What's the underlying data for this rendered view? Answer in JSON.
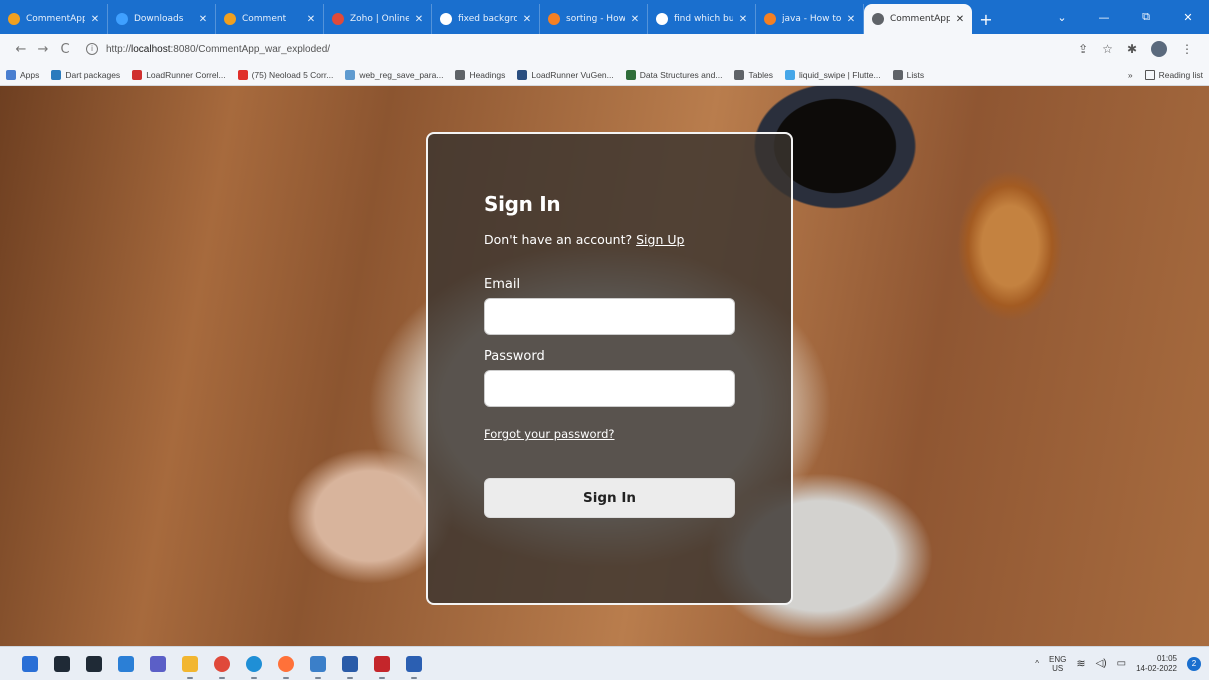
{
  "browser": {
    "tabs": [
      {
        "title": "CommentApp",
        "color": "#f0a020",
        "active": false
      },
      {
        "title": "Downloads",
        "color": "#3fa0ff",
        "active": false
      },
      {
        "title": "Comment",
        "color": "#f0a020",
        "active": false
      },
      {
        "title": "Zoho | Online",
        "color": "#e04a3a",
        "active": false
      },
      {
        "title": "fixed backgro",
        "color": "#ffffff",
        "active": false
      },
      {
        "title": "sorting - How",
        "color": "#f48024",
        "active": false
      },
      {
        "title": "find which but",
        "color": "#ffffff",
        "active": false
      },
      {
        "title": "java - How to",
        "color": "#f48024",
        "active": false
      },
      {
        "title": "CommentApp",
        "color": "#5f6368",
        "active": true
      }
    ],
    "new_tab": "+",
    "window_controls": {
      "chevron": "⌄",
      "minimize": "—",
      "restore": "⧉",
      "close": "✕"
    },
    "url": {
      "scheme": "http://",
      "host": "localhost",
      "rest": ":8080/CommentApp_war_exploded/"
    },
    "bookmarks": [
      {
        "label": "Apps",
        "color": "#4a7fd0"
      },
      {
        "label": "Dart packages",
        "color": "#2b7bbd"
      },
      {
        "label": "LoadRunner Correl...",
        "color": "#d0302f"
      },
      {
        "label": "(75) Neoload 5 Corr...",
        "color": "#e0302b"
      },
      {
        "label": "web_reg_save_para...",
        "color": "#5f9bd0"
      },
      {
        "label": "Headings",
        "color": "#5f6368"
      },
      {
        "label": "LoadRunner VuGen...",
        "color": "#2b4f80"
      },
      {
        "label": "Data Structures and...",
        "color": "#2f6d3a"
      },
      {
        "label": "Tables",
        "color": "#5f6368"
      },
      {
        "label": "liquid_swipe | Flutte...",
        "color": "#45a6e8"
      },
      {
        "label": "Lists",
        "color": "#5f6368"
      }
    ],
    "bookmarks_overflow": "»",
    "reading_list": "Reading list"
  },
  "signin": {
    "title": "Sign In",
    "no_account": "Don't have an account?",
    "signup_link": "Sign Up",
    "email_label": "Email",
    "email_value": "",
    "password_label": "Password",
    "password_value": "",
    "forgot_link": "Forgot your password?",
    "submit_label": "Sign In"
  },
  "taskbar": {
    "apps": [
      {
        "name": "start",
        "color": "#2a6fd6"
      },
      {
        "name": "search",
        "color": "#1f2a36"
      },
      {
        "name": "task-view",
        "color": "#1f2a36"
      },
      {
        "name": "widgets",
        "color": "#2b7fd6"
      },
      {
        "name": "chat",
        "color": "#5b5fc7"
      },
      {
        "name": "file-explorer",
        "color": "#f2b630"
      },
      {
        "name": "chrome",
        "color": "#e0493a"
      },
      {
        "name": "edge",
        "color": "#1f8fd6"
      },
      {
        "name": "firefox",
        "color": "#ff7139"
      },
      {
        "name": "notepad",
        "color": "#3b7fc9"
      },
      {
        "name": "photos",
        "color": "#2a5ba8"
      },
      {
        "name": "app-red",
        "color": "#c4262b"
      },
      {
        "name": "word",
        "color": "#2b5fb2"
      }
    ],
    "lang_top": "ENG",
    "lang_bottom": "US",
    "time": "01:05",
    "date": "14-02-2022",
    "notifications": "2"
  }
}
